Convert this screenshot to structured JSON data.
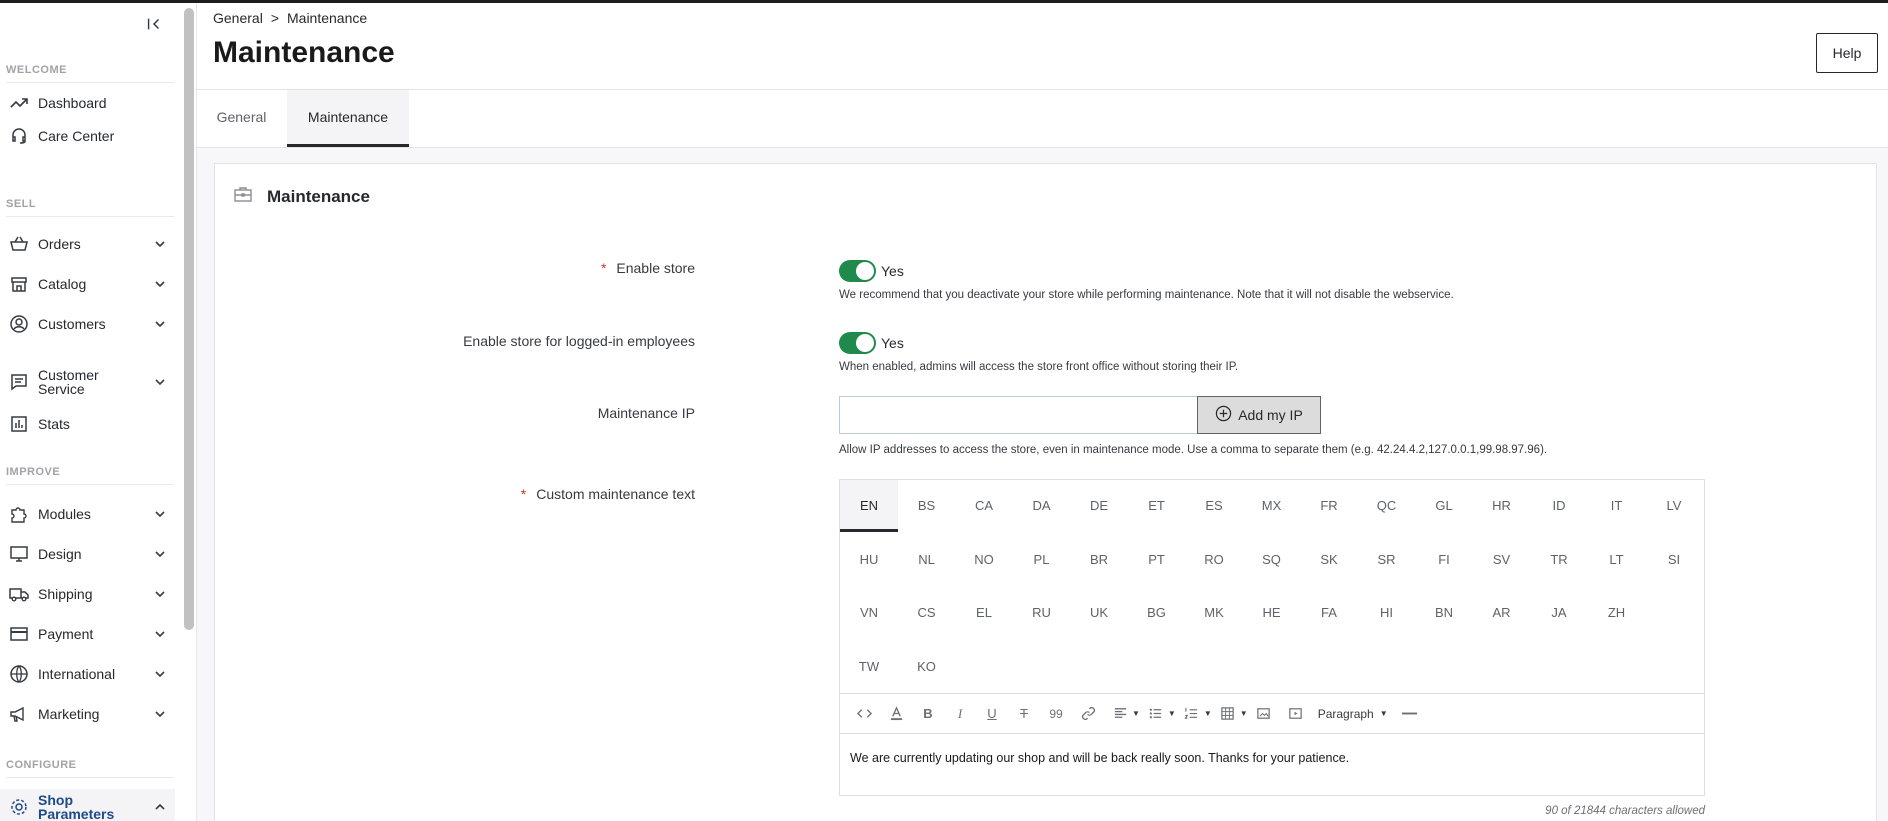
{
  "sidebar": {
    "sections": {
      "welcome": "WELCOME",
      "sell": "SELL",
      "improve": "IMPROVE",
      "configure": "CONFIGURE"
    },
    "items": [
      {
        "label": "Dashboard"
      },
      {
        "label": "Care Center"
      },
      {
        "label": "Orders"
      },
      {
        "label": "Catalog"
      },
      {
        "label": "Customers"
      },
      {
        "label": "Customer Service"
      },
      {
        "label": "Stats"
      },
      {
        "label": "Modules"
      },
      {
        "label": "Design"
      },
      {
        "label": "Shipping"
      },
      {
        "label": "Payment"
      },
      {
        "label": "International"
      },
      {
        "label": "Marketing"
      },
      {
        "label": "Shop Parameters"
      }
    ]
  },
  "header": {
    "breadcrumb": [
      "General",
      ">",
      "Maintenance"
    ],
    "title": "Maintenance",
    "help_label": "Help"
  },
  "tabs": [
    {
      "label": "General",
      "active": false
    },
    {
      "label": "Maintenance",
      "active": true
    }
  ],
  "card": {
    "title": "Maintenance"
  },
  "form": {
    "enable_store": {
      "label": "Enable store",
      "required_mark": "*",
      "value": "Yes",
      "help": "We recommend that you deactivate your store while performing maintenance. Note that it will not disable the webservice."
    },
    "enable_employees": {
      "label": "Enable store for logged-in employees",
      "value": "Yes",
      "help": "When enabled, admins will access the store front office without storing their IP."
    },
    "maintenance_ip": {
      "label": "Maintenance IP",
      "value": "",
      "button_label": "Add my IP",
      "help": "Allow IP addresses to access the store, even in maintenance mode. Use a comma to separate them (e.g. 42.24.4.2,127.0.0.1,99.98.97.96)."
    },
    "custom_text": {
      "label": "Custom maintenance text",
      "required_mark": "*",
      "languages": [
        [
          "EN",
          "BS",
          "CA",
          "DA",
          "DE",
          "ET",
          "ES",
          "MX",
          "FR",
          "QC",
          "GL",
          "HR",
          "ID",
          "IT",
          "LV"
        ],
        [
          "HU",
          "NL",
          "NO",
          "PL",
          "BR",
          "PT",
          "RO",
          "SQ",
          "SK",
          "SR",
          "FI",
          "SV",
          "TR",
          "LT",
          "SI"
        ],
        [
          "VN",
          "CS",
          "EL",
          "RU",
          "UK",
          "BG",
          "MK",
          "HE",
          "FA",
          "HI",
          "BN",
          "AR",
          "JA",
          "ZH"
        ],
        [
          "TW",
          "KO"
        ]
      ],
      "active_language": "EN",
      "paragraph_label": "Paragraph",
      "content": "We are currently updating our shop and will be back really soon. Thanks for your patience.",
      "char_count": "90 of 21844 characters allowed"
    }
  },
  "colors": {
    "toggle_on": "#1f8a4c",
    "active_nav": "#1f4a8a",
    "required": "#c0392b"
  }
}
